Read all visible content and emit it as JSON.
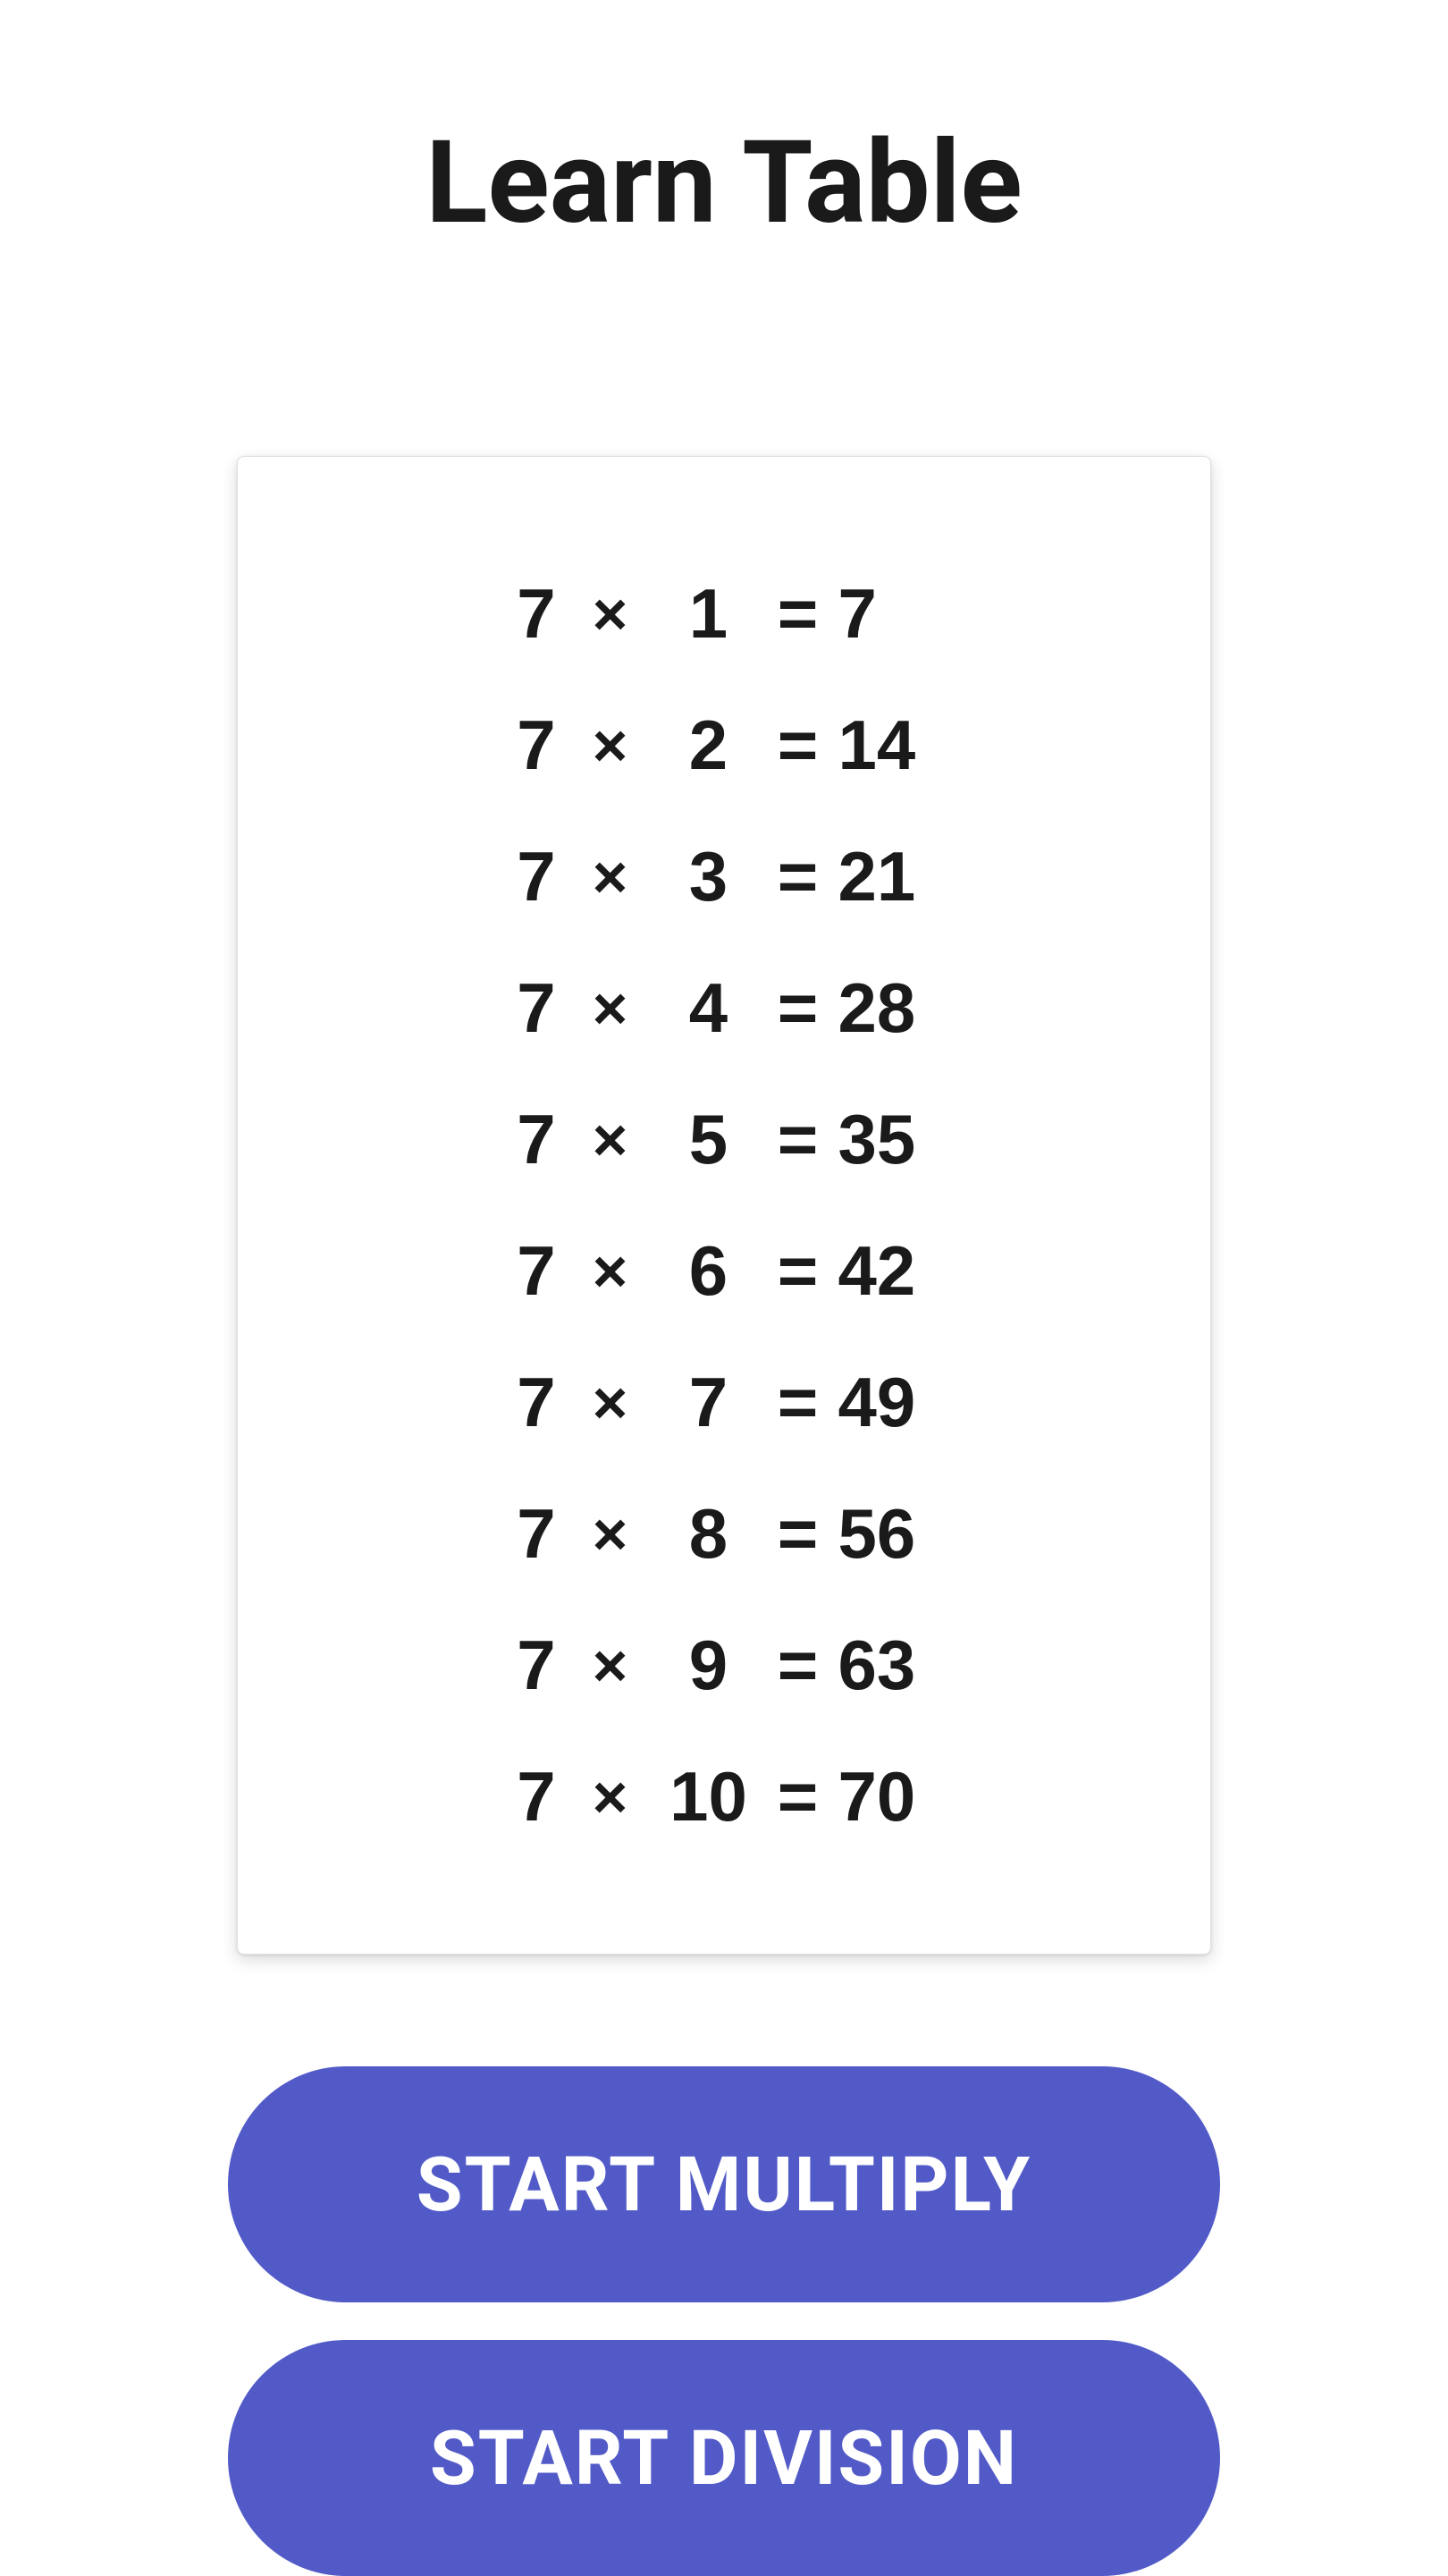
{
  "title": "Learn Table",
  "chart_data": {
    "type": "table",
    "operator": "×",
    "equals": "=",
    "rows": [
      {
        "a": 7,
        "b": 1,
        "result": 7
      },
      {
        "a": 7,
        "b": 2,
        "result": 14
      },
      {
        "a": 7,
        "b": 3,
        "result": 21
      },
      {
        "a": 7,
        "b": 4,
        "result": 28
      },
      {
        "a": 7,
        "b": 5,
        "result": 35
      },
      {
        "a": 7,
        "b": 6,
        "result": 42
      },
      {
        "a": 7,
        "b": 7,
        "result": 49
      },
      {
        "a": 7,
        "b": 8,
        "result": 56
      },
      {
        "a": 7,
        "b": 9,
        "result": 63
      },
      {
        "a": 7,
        "b": 10,
        "result": 70
      }
    ]
  },
  "buttons": {
    "multiply": "START MULTIPLY",
    "division": "START DIVISION"
  },
  "colors": {
    "accent": "#525ac8",
    "text": "#1a1a1a",
    "background": "#ffffff"
  }
}
